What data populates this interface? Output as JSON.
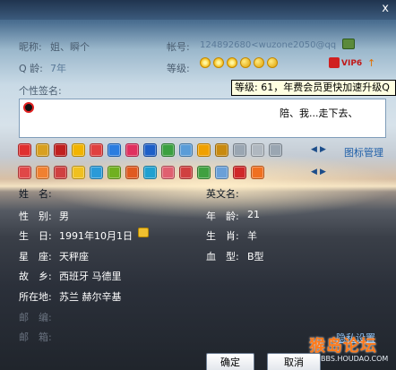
{
  "window": {
    "close_glyph": "x"
  },
  "basic": {
    "nickname_label": "昵称:",
    "nickname_value": "姐、瞬个",
    "account_label": "帐号:",
    "account_value": "124892680<wuzone2050@qq",
    "qage_label": "Q 龄:",
    "qage_value": "7年",
    "level_label": "等级:",
    "vip_text": "VIP6",
    "signature_label": "个性签名:"
  },
  "tooltip": {
    "text": "等级: 61，年费会员更快加速升级Q"
  },
  "signature": {
    "text": "陪、我...走下去、"
  },
  "icons": {
    "manage_label": "图标管理",
    "row1_colors": [
      "#e03030",
      "#d8a020",
      "#c02020",
      "#f2b400",
      "#e04040",
      "#2b7de0",
      "#e03060",
      "#1d5fc8",
      "#3aa040",
      "#5a9cd8",
      "#f0a000",
      "#c88a10",
      "#9aa6b2",
      "#b0b8c0",
      "#9aa6b2"
    ],
    "row2_colors": [
      "#e04848",
      "#f08030",
      "#d04040",
      "#f0c020",
      "#2a9ad8",
      "#70b020",
      "#e05a20",
      "#20a0d0",
      "#e06070",
      "#d04040",
      "#40a040",
      "#6aa0d8",
      "#d02828",
      "#f07020"
    ]
  },
  "details": {
    "name_label": "姓　名:",
    "english_name_label": "英文名:",
    "gender_label": "性　别:",
    "gender_value": "男",
    "age_label": "年　龄:",
    "age_value": "21",
    "birthday_label": "生　日:",
    "birthday_value": "1991年10月1日",
    "zodiac_label": "生　肖:",
    "zodiac_value": "羊",
    "star_label": "星　座:",
    "star_value": "天秤座",
    "blood_label": "血　型:",
    "blood_value": "B型",
    "hometown_label": "故　乡:",
    "hometown_value": "西班牙 马德里",
    "location_label": "所在地:",
    "location_value": "苏兰 赫尔辛基",
    "row8_label": "邮　编:",
    "row9_label": "邮　箱:"
  },
  "links": {
    "privacy": "隐私设置"
  },
  "buttons": {
    "ok": "确定",
    "cancel": "取消"
  },
  "watermark": {
    "main": "猴岛论坛",
    "sub": "BBS.HOUDAO.COM"
  }
}
